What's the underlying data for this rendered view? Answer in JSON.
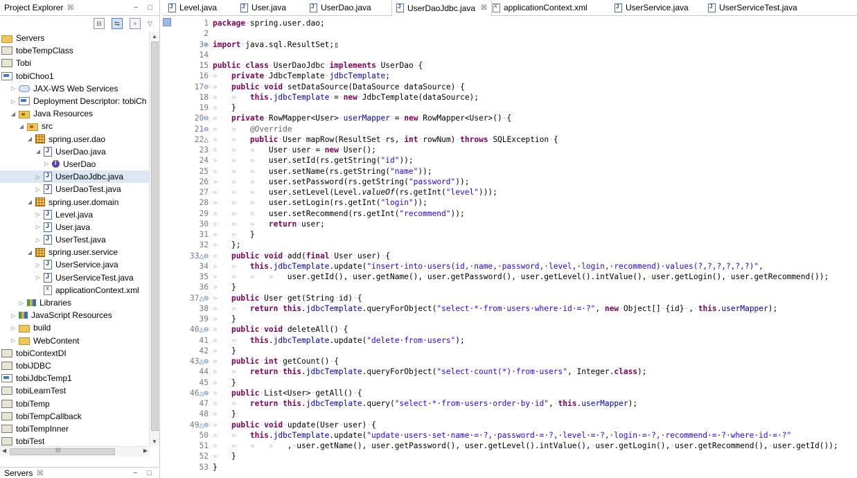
{
  "explorer": {
    "title": "Project Explorer",
    "close": "☒",
    "minimize": "−",
    "maximize": "□",
    "tree": [
      {
        "label": "Servers",
        "icon": "folder",
        "indent": 0,
        "twisty": ""
      },
      {
        "label": "tobeTempClass",
        "icon": "project",
        "indent": 0,
        "twisty": ""
      },
      {
        "label": "Tobi",
        "icon": "project",
        "indent": 0,
        "twisty": ""
      },
      {
        "label": "tobiChoo1",
        "icon": "web",
        "indent": 0,
        "twisty": ""
      },
      {
        "label": "JAX-WS Web Services",
        "icon": "cloud",
        "indent": 1,
        "twisty": "▷"
      },
      {
        "label": "Deployment Descriptor: tobiCh",
        "icon": "web",
        "indent": 1,
        "twisty": "▷"
      },
      {
        "label": "Java Resources",
        "icon": "src",
        "indent": 1,
        "twisty": "◢"
      },
      {
        "label": "src",
        "icon": "src",
        "indent": 2,
        "twisty": "◢"
      },
      {
        "label": "spring.user.dao",
        "icon": "pkg",
        "indent": 3,
        "twisty": "◢"
      },
      {
        "label": "UserDao.java",
        "icon": "java",
        "indent": 4,
        "twisty": "◢"
      },
      {
        "label": "UserDao",
        "icon": "iface",
        "indent": 5,
        "twisty": "▷"
      },
      {
        "label": "UserDaoJdbc.java",
        "icon": "java",
        "indent": 4,
        "twisty": "▷",
        "selected": true
      },
      {
        "label": "UserDaoTest.java",
        "icon": "java",
        "indent": 4,
        "twisty": "▷"
      },
      {
        "label": "spring.user.domain",
        "icon": "pkg",
        "indent": 3,
        "twisty": "◢"
      },
      {
        "label": "Level.java",
        "icon": "java",
        "indent": 4,
        "twisty": "▷"
      },
      {
        "label": "User.java",
        "icon": "java",
        "indent": 4,
        "twisty": "▷"
      },
      {
        "label": "UserTest.java",
        "icon": "java",
        "indent": 4,
        "twisty": "▷"
      },
      {
        "label": "spring.user.service",
        "icon": "pkg",
        "indent": 3,
        "twisty": "◢"
      },
      {
        "label": "UserService.java",
        "icon": "java",
        "indent": 4,
        "twisty": "▷"
      },
      {
        "label": "UserServiceTest.java",
        "icon": "java",
        "indent": 4,
        "twisty": "▷"
      },
      {
        "label": "applicationContext.xml",
        "icon": "xml",
        "indent": 4,
        "twisty": ""
      },
      {
        "label": "Libraries",
        "icon": "lib",
        "indent": 2,
        "twisty": "▷"
      },
      {
        "label": "JavaScript Resources",
        "icon": "lib",
        "indent": 1,
        "twisty": "▷"
      },
      {
        "label": "build",
        "icon": "folder",
        "indent": 1,
        "twisty": "▷"
      },
      {
        "label": "WebContent",
        "icon": "folder",
        "indent": 1,
        "twisty": "▷"
      },
      {
        "label": "tobiContextDI",
        "icon": "project",
        "indent": 0,
        "twisty": ""
      },
      {
        "label": "tobiJDBC",
        "icon": "project",
        "indent": 0,
        "twisty": ""
      },
      {
        "label": "tobiJdbcTemp1",
        "icon": "web",
        "indent": 0,
        "twisty": ""
      },
      {
        "label": "tobiLearnTest",
        "icon": "project",
        "indent": 0,
        "twisty": ""
      },
      {
        "label": "tobiTemp",
        "icon": "project",
        "indent": 0,
        "twisty": ""
      },
      {
        "label": "tobiTempCallback",
        "icon": "project",
        "indent": 0,
        "twisty": ""
      },
      {
        "label": "tobiTempInner",
        "icon": "project",
        "indent": 0,
        "twisty": ""
      },
      {
        "label": "tobiTest",
        "icon": "project",
        "indent": 0,
        "twisty": ""
      }
    ],
    "hscroll_grip": "III"
  },
  "servers_panel": {
    "title": "Servers"
  },
  "editor": {
    "tabs": [
      {
        "label": "Level.java",
        "icon": "java"
      },
      {
        "label": "User.java",
        "icon": "java"
      },
      {
        "label": "UserDao.java",
        "icon": "java"
      },
      {
        "label": "UserDaoJdbc.java",
        "icon": "java",
        "active": true
      },
      {
        "label": "applicationContext.xml",
        "icon": "xml"
      },
      {
        "label": "UserService.java",
        "icon": "java"
      },
      {
        "label": "UserServiceTest.java",
        "icon": "java"
      }
    ],
    "lines": [
      {
        "n": "1",
        "m": "",
        "t": "<span class=\"kw\">package</span><span class=\"ws\">·</span>spring.user.dao;"
      },
      {
        "n": "2",
        "m": "",
        "t": ""
      },
      {
        "n": "3",
        "m": "⊕",
        "t": "<span class=\"kw\">import</span><span class=\"ws\">·</span>java.sql.ResultSet;▯"
      },
      {
        "n": "14",
        "m": "",
        "t": ""
      },
      {
        "n": "15",
        "m": "",
        "t": "<span class=\"kw\">public</span><span class=\"ws\">·</span><span class=\"kw\">class</span><span class=\"ws\">·</span>UserDaoJdbc<span class=\"ws\">·</span><span class=\"kw\">implements</span><span class=\"ws\">·</span>UserDao<span class=\"ws\">·</span>{"
      },
      {
        "n": "16",
        "m": "",
        "t": "<span class=\"ws\">»   </span><span class=\"kw\">private</span><span class=\"ws\">·</span>JdbcTemplate<span class=\"ws\">·</span><span class=\"fld\">jdbcTemplate</span>;"
      },
      {
        "n": "17",
        "m": "⊖",
        "t": "<span class=\"ws\">»   </span><span class=\"kw\">public</span><span class=\"ws\">·</span><span class=\"kw\">void</span><span class=\"ws\">·</span>setDataSource(DataSource<span class=\"ws\">·</span>dataSource)<span class=\"ws\">·</span>{"
      },
      {
        "n": "18",
        "m": "",
        "t": "<span class=\"ws\">»   »   </span><span class=\"kw\">this</span>.<span class=\"fld\">jdbcTemplate</span><span class=\"ws\">·</span>=<span class=\"ws\">·</span><span class=\"kw\">new</span><span class=\"ws\">·</span>JdbcTemplate(dataSource);"
      },
      {
        "n": "19",
        "m": "",
        "t": "<span class=\"ws\">»   </span>}"
      },
      {
        "n": "20",
        "m": "⊖",
        "t": "<span class=\"ws\">»   </span><span class=\"kw\">private</span><span class=\"ws\">·</span>RowMapper&lt;User&gt;<span class=\"ws\">·</span><span class=\"fld\">userMapper</span><span class=\"ws\">·</span>=<span class=\"ws\">·</span><span class=\"kw\">new</span><span class=\"ws\">·</span>RowMapper&lt;User&gt;()<span class=\"ws\">·</span>{"
      },
      {
        "n": "21",
        "m": "⊖",
        "t": "<span class=\"ws\">»   »   </span><span class=\"ann\">@Override</span>"
      },
      {
        "n": "22",
        "m": "△",
        "t": "<span class=\"ws\">»   »   </span><span class=\"kw\">public</span><span class=\"ws\">·</span>User<span class=\"ws\">·</span>mapRow(ResultSet<span class=\"ws\">·</span>rs,<span class=\"ws\">·</span><span class=\"kw\">int</span><span class=\"ws\">·</span>rowNum)<span class=\"ws\">·</span><span class=\"kw\">throws</span><span class=\"ws\">·</span>SQLException<span class=\"ws\">·</span>{"
      },
      {
        "n": "23",
        "m": "",
        "t": "<span class=\"ws\">»   »   »   </span>User<span class=\"ws\">·</span>user<span class=\"ws\">·</span>=<span class=\"ws\">·</span><span class=\"kw\">new</span><span class=\"ws\">·</span>User();"
      },
      {
        "n": "24",
        "m": "",
        "t": "<span class=\"ws\">»   »   »   </span>user.setId(rs.getString(<span class=\"str\">\"id\"</span>));"
      },
      {
        "n": "25",
        "m": "",
        "t": "<span class=\"ws\">»   »   »   </span>user.setName(rs.getString(<span class=\"str\">\"name\"</span>));"
      },
      {
        "n": "26",
        "m": "",
        "t": "<span class=\"ws\">»   »   »   </span>user.setPassword(rs.getString(<span class=\"str\">\"password\"</span>));"
      },
      {
        "n": "27",
        "m": "",
        "t": "<span class=\"ws\">»   »   »   </span>user.setLevel(Level.<span class=\"ital\">valueOf</span>(rs.getInt(<span class=\"str\">\"level\"</span>)));"
      },
      {
        "n": "28",
        "m": "",
        "t": "<span class=\"ws\">»   »   »   </span>user.setLogin(rs.getInt(<span class=\"str\">\"login\"</span>));"
      },
      {
        "n": "29",
        "m": "",
        "t": "<span class=\"ws\">»   »   »   </span>user.setRecommend(rs.getInt(<span class=\"str\">\"recommend\"</span>));"
      },
      {
        "n": "30",
        "m": "",
        "t": "<span class=\"ws\">»   »   »   </span><span class=\"kw\">return</span><span class=\"ws\">·</span>user;"
      },
      {
        "n": "31",
        "m": "",
        "t": "<span class=\"ws\">»   »   </span>}"
      },
      {
        "n": "32",
        "m": "",
        "t": "<span class=\"ws\">»   </span>};"
      },
      {
        "n": "33",
        "m": "△⊖",
        "t": "<span class=\"ws\">»   </span><span class=\"kw\">public</span><span class=\"ws\">·</span><span class=\"kw\">void</span><span class=\"ws\">·</span>add(<span class=\"kw\">final</span><span class=\"ws\">·</span>User<span class=\"ws\">·</span>user)<span class=\"ws\">·</span>{"
      },
      {
        "n": "34",
        "m": "",
        "t": "<span class=\"ws\">»   »   </span><span class=\"kw\">this</span>.<span class=\"fld\">jdbcTemplate</span>.update(<span class=\"str\">\"insert·into·users(id,·name,·password,·level,·login,·recommend)·values(?,?,?,?,?,?)\"</span>,"
      },
      {
        "n": "35",
        "m": "",
        "t": "<span class=\"ws\">»   »   »   »   </span>user.getId(),<span class=\"ws\">·</span>user.getName(),<span class=\"ws\">·</span>user.getPassword(),<span class=\"ws\">·</span>user.getLevel().intValue(),<span class=\"ws\">·</span>user.getLogin(),<span class=\"ws\">·</span>user.getRecommend());"
      },
      {
        "n": "36",
        "m": "",
        "t": "<span class=\"ws\">»   </span>}"
      },
      {
        "n": "37",
        "m": "△⊖",
        "t": "<span class=\"ws\">»   </span><span class=\"kw\">public</span><span class=\"ws\">·</span>User<span class=\"ws\">·</span>get(String<span class=\"ws\">·</span>id)<span class=\"ws\">·</span>{"
      },
      {
        "n": "38",
        "m": "",
        "t": "<span class=\"ws\">»   »   </span><span class=\"kw\">return</span><span class=\"ws\">·</span><span class=\"kw\">this</span>.<span class=\"fld\">jdbcTemplate</span>.queryForObject(<span class=\"str\">\"select·*·from·users·where·id·=·?\"</span>,<span class=\"ws\">·</span><span class=\"kw\">new</span><span class=\"ws\">·</span>Object[]<span class=\"ws\">·</span>{id}<span class=\"ws\">·</span>,<span class=\"ws\">·</span><span class=\"kw\">this</span>.<span class=\"fld\">userMapper</span>);"
      },
      {
        "n": "39",
        "m": "",
        "t": "<span class=\"ws\">»   </span>}"
      },
      {
        "n": "40",
        "m": "△⊖",
        "t": "<span class=\"ws\">»   </span><span class=\"kw\">public</span><span class=\"ws\">·</span><span class=\"kw\">void</span><span class=\"ws\">·</span>deleteAll()<span class=\"ws\">·</span>{"
      },
      {
        "n": "41",
        "m": "",
        "t": "<span class=\"ws\">»   »   </span><span class=\"kw\">this</span>.<span class=\"fld\">jdbcTemplate</span>.update(<span class=\"str\">\"delete·from·users\"</span>);"
      },
      {
        "n": "42",
        "m": "",
        "t": "<span class=\"ws\">»   </span>}"
      },
      {
        "n": "43",
        "m": "△⊖",
        "t": "<span class=\"ws\">»   </span><span class=\"kw\">public</span><span class=\"ws\">·</span><span class=\"kw\">int</span><span class=\"ws\">·</span>getCount()<span class=\"ws\">·</span>{"
      },
      {
        "n": "44",
        "m": "",
        "t": "<span class=\"ws\">»   »   </span><span class=\"kw\">return</span><span class=\"ws\">·</span><span class=\"kw\">this</span>.<span class=\"fld\">jdbcTemplate</span>.queryForObject(<span class=\"str\">\"select·count(*)·from·users\"</span>,<span class=\"ws\">·</span>Integer.<span class=\"kw\">class</span>);"
      },
      {
        "n": "45",
        "m": "",
        "t": "<span class=\"ws\">»   </span>}"
      },
      {
        "n": "46",
        "m": "△⊖",
        "t": "<span class=\"ws\">»   </span><span class=\"kw\">public</span><span class=\"ws\">·</span>List&lt;User&gt;<span class=\"ws\">·</span>getAll()<span class=\"ws\">·</span>{"
      },
      {
        "n": "47",
        "m": "",
        "t": "<span class=\"ws\">»   »   </span><span class=\"kw\">return</span><span class=\"ws\">·</span><span class=\"kw\">this</span>.<span class=\"fld\">jdbcTemplate</span>.query(<span class=\"str\">\"select·*·from·users·order·by·id\"</span>,<span class=\"ws\">·</span><span class=\"kw\">this</span>.<span class=\"fld\">userMapper</span>);"
      },
      {
        "n": "48",
        "m": "",
        "t": "<span class=\"ws\">»   </span>}"
      },
      {
        "n": "49",
        "m": "△⊖",
        "t": "<span class=\"ws\">»   </span><span class=\"kw\">public</span><span class=\"ws\">·</span><span class=\"kw\">void</span><span class=\"ws\">·</span>update(User<span class=\"ws\">·</span>user)<span class=\"ws\">·</span>{"
      },
      {
        "n": "50",
        "m": "",
        "t": "<span class=\"ws\">»   »   </span><span class=\"kw\">this</span>.<span class=\"fld\">jdbcTemplate</span>.update(<span class=\"str\">\"update·users·set·name·=·?,·password·=·?,·level·=·?,·login·=·?,·recommend·=·?·where·id·=·?\"</span>"
      },
      {
        "n": "51",
        "m": "",
        "t": "<span class=\"ws\">»   »   »   »   </span>,<span class=\"ws\">·</span>user.getName(),<span class=\"ws\">·</span>user.getPassword(),<span class=\"ws\">·</span>user.getLevel().intValue(),<span class=\"ws\">·</span>user.getLogin(),<span class=\"ws\">·</span>user.getRecommend(),<span class=\"ws\">·</span>user.getId());"
      },
      {
        "n": "52",
        "m": "",
        "t": "<span class=\"ws\">»   </span>}"
      },
      {
        "n": "53",
        "m": "",
        "t": "}"
      }
    ]
  }
}
